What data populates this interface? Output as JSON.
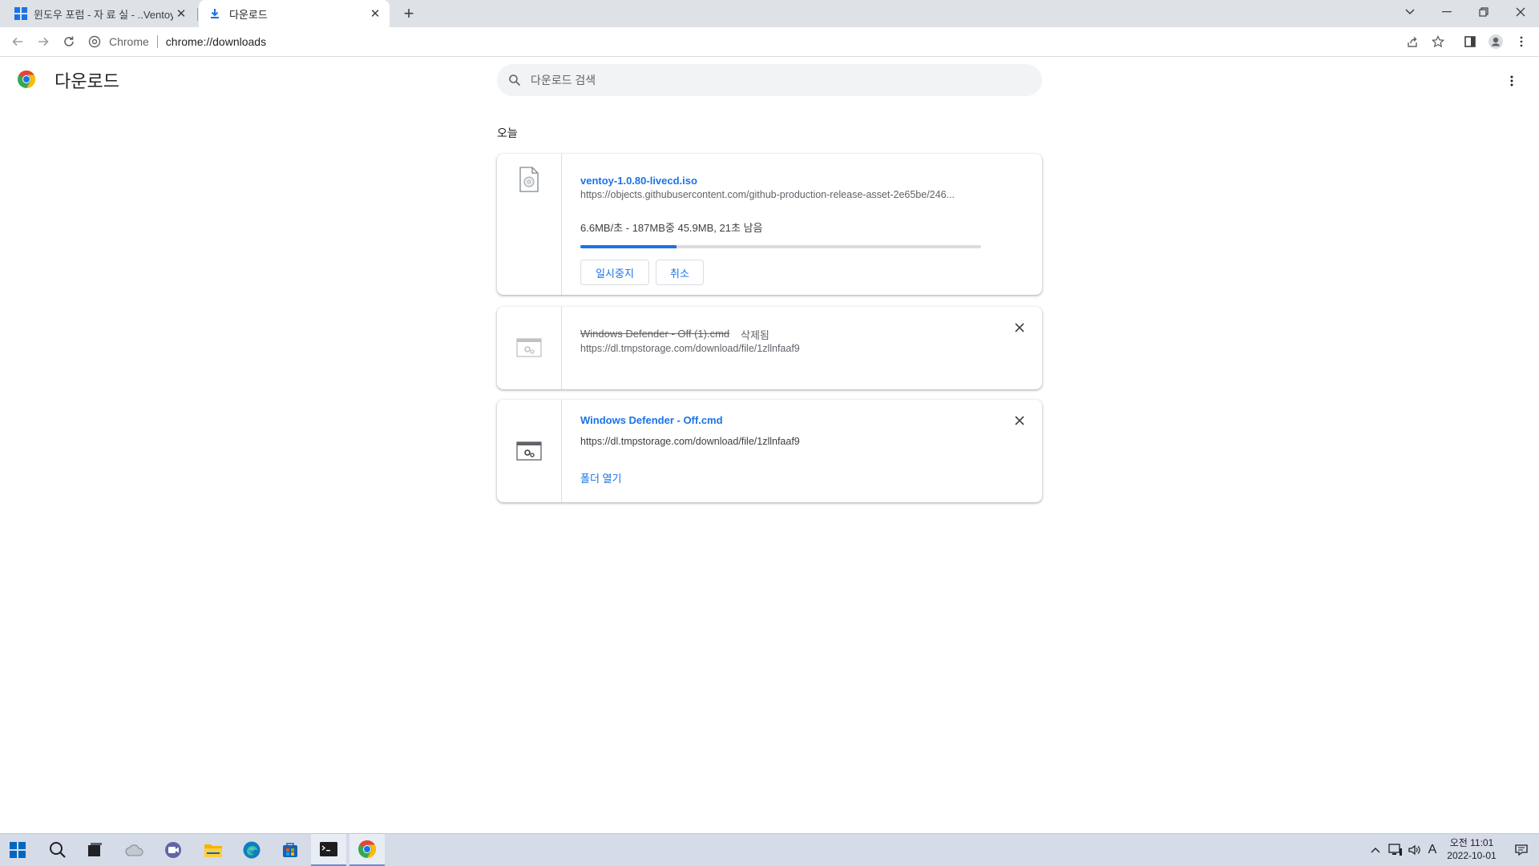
{
  "tabs": [
    {
      "title": "윈도우 포럼 - 자 료 실 - ..Ventoy",
      "active": false,
      "icon": "windows-logo-icon"
    },
    {
      "title": "다운로드",
      "active": true,
      "icon": "download-icon"
    }
  ],
  "toolbar": {
    "site_label": "Chrome",
    "url": "chrome://downloads"
  },
  "page": {
    "title": "다운로드",
    "search_placeholder": "다운로드 검색",
    "date_group": "오늘"
  },
  "downloads": [
    {
      "filename": "ventoy-1.0.80-livecd.iso",
      "url": "https://objects.githubusercontent.com/github-production-release-asset-2e65be/246...",
      "status": "6.6MB/초 - 187MB중 45.9MB, 21초 남음",
      "progress_percent": 24,
      "pause_label": "일시중지",
      "cancel_label": "취소",
      "file_icon": "disc-image-icon"
    },
    {
      "filename": "Windows Defender - Off (1).cmd",
      "deleted_label": "삭제됨",
      "url": "https://dl.tmpstorage.com/download/file/1zllnfaaf9",
      "file_icon": "settings-file-icon"
    },
    {
      "filename": "Windows Defender - Off.cmd",
      "url": "https://dl.tmpstorage.com/download/file/1zllnfaaf9",
      "open_folder_label": "폴더 열기",
      "file_icon": "settings-file-icon"
    }
  ],
  "taskbar": {
    "clock_time": "오전 11:01",
    "clock_date": "2022-10-01",
    "ime_label": "A"
  },
  "colors": {
    "accent": "#1a73e8",
    "tabstrip": "#dee1e6",
    "taskbar": "#d6dbe8"
  }
}
